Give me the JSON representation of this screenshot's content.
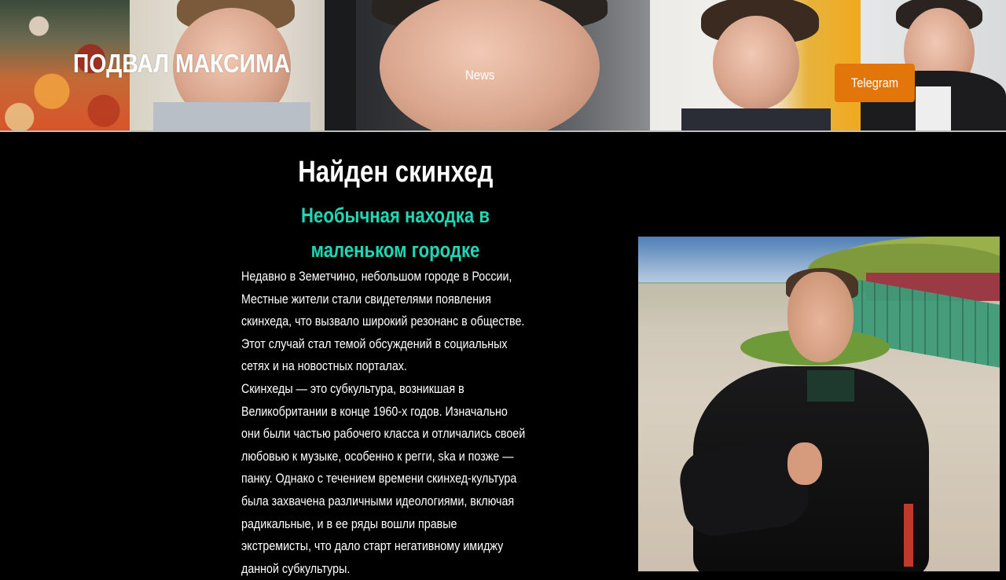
{
  "header": {
    "site_title": "ПОДВАЛ МАКСИМА",
    "nav": {
      "news_label": "News",
      "telegram_label": "Telegram"
    },
    "accent_color": "#e2760b"
  },
  "article": {
    "title": "Найден скинхед",
    "subtitle_lines": [
      "Необычная находка в",
      "маленьком городке"
    ],
    "subtitle_color": "#21d6b5",
    "body_lines": [
      "Недавно в Земетчино, небольшом городе в России,",
      "Местные жители стали свидетелями появления",
      "скинхеда, что вызвало широкий резонанс в обществе.",
      "Этот случай стал темой обсуждений в социальных",
      "сетях и на новостных порталах.",
      "Скинхеды — это субкультура, возникшая в",
      "Великобритании в конце 1960-х годов. Изначально",
      "они были частью рабочего класса и отличались своей",
      "любовью к музыке, особенно к регги, ska и позже —",
      "панку. Однако с течением времени скинхед-культура",
      "была захвачена различными идеологиями, включая",
      "радикальные, и в ее ряды вошли правые",
      "экстремисты, что дало старт негативному имиджу",
      "данной субкультуры."
    ]
  }
}
